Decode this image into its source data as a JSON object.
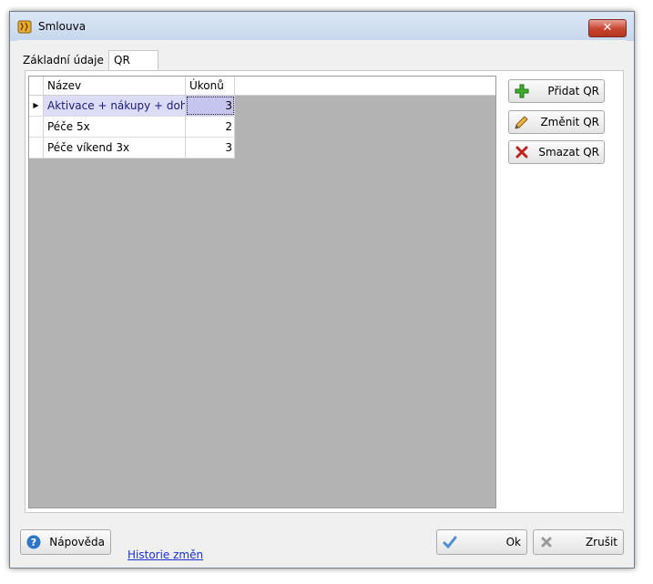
{
  "window": {
    "title": "Smlouva",
    "close_label": "✕"
  },
  "tabs": [
    {
      "label": "Základní údaje",
      "active": false
    },
    {
      "label": "QR",
      "active": true
    }
  ],
  "grid": {
    "columns": [
      "Název",
      "Úkonů"
    ],
    "rows": [
      {
        "name": "Aktivace + nákupy + dohled",
        "count": "3",
        "selected": true
      },
      {
        "name": "Péče 5x",
        "count": "2",
        "selected": false
      },
      {
        "name": "Péče víkend 3x",
        "count": "3",
        "selected": false
      }
    ],
    "current_row_marker": "▶"
  },
  "side_buttons": {
    "add": {
      "label": "Přidat QR",
      "icon": "plus-icon"
    },
    "edit": {
      "label": "Změnit QR",
      "icon": "pencil-icon"
    },
    "delete": {
      "label": "Smazat QR",
      "icon": "x-icon"
    }
  },
  "footer": {
    "help_label": "Nápověda",
    "history_link": "Historie změn",
    "ok_label": "Ok",
    "cancel_label": "Zrušit"
  },
  "colors": {
    "selected_row": "#dcdcf7",
    "grid_background": "#b3b3b3",
    "link": "#1a2ed8"
  }
}
